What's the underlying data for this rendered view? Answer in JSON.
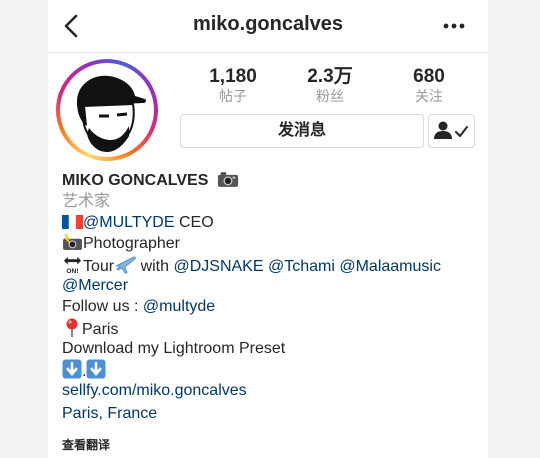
{
  "nav": {
    "username": "miko.goncalves",
    "back_icon": "chevron-left-icon",
    "more_icon": "more-dots-icon"
  },
  "profile": {
    "avatar_icon": "avatar-illustration",
    "stats": [
      {
        "value": "1,180",
        "label": "帖子"
      },
      {
        "value": "2.3万",
        "label": "粉丝"
      },
      {
        "value": "680",
        "label": "关注"
      }
    ],
    "message_label": "发消息",
    "follow_icon": "person-check-icon"
  },
  "bio": {
    "name": "MIKO GONCALVES",
    "category": "艺术家",
    "line1_link": "@MULTYDE",
    "line1_text": " CEO",
    "line2_text": "Photographer",
    "line3_tour": "Tour",
    "line3_with": " with ",
    "line3_mentions": [
      "@DJSNAKE",
      "@Tchami",
      "@Malaamusic"
    ],
    "line4_mention": "@Mercer",
    "line5_prefix": "Follow us : ",
    "line5_link": "@multyde",
    "line6_text": "Paris",
    "line7_text": "Download my Lightroom Preset",
    "line8_dot": ".",
    "website": "sellfy.com/miko.goncalves",
    "location": "Paris, France",
    "translate": "查看翻译"
  },
  "colors": {
    "link": "#00376b",
    "secondary_text": "#999999",
    "primary_text": "#262626"
  }
}
